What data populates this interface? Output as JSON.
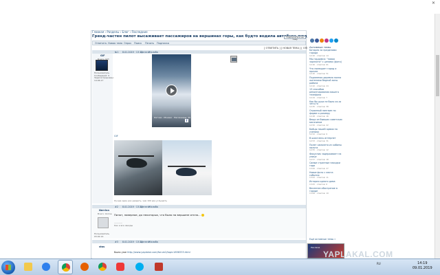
{
  "window": {
    "breadcrumb_label": "Главная › Разделы › Блог › Последние"
  },
  "thread": {
    "title": "Гренд-частен пилот высаживает пассажиров на вершинах горы, как будто водила автобуса людей на остановке",
    "subscribe_button": "Подписаться на тему",
    "toolbar": [
      "Ответить",
      "Новая тема",
      "Опрос",
      "Поиск",
      "Печать",
      "Подписка"
    ],
    "pagination": "[ ОТВЕТИТЬ ] [ НОВАЯ ТЕМА ] [ ОПРОС ]"
  },
  "post1": {
    "header_items": [
      "№1",
      "8.01.2019 · 13:15",
      "Цитата",
      "Жалоба"
    ],
    "username": "GiF",
    "status": "Всего: 373 сообщ.",
    "user_info": "Пользователь\nСообщений: 9\nЗарегистрирован: 14.06.17",
    "video_caption": "Летчик - Монако · Пассажиры: 59",
    "facebook_glyph": "f",
    "small_link": "GIF",
    "footer": "Лучше один раз увидеть, чем 100 раз услышать"
  },
  "post2": {
    "header_items": [
      "#2",
      "8.01.2019 · 13:20",
      "Цитата",
      "Жалоба"
    ],
    "username": "Nerrinn",
    "status": "Всего: Online",
    "user_info": "Пользователь\n03.02.14",
    "message": "Пилот, наверное, до некоторых, что было на вершине отеля...",
    "signature": "————\nКак и все звезды"
  },
  "post3": {
    "header_items": [
      "#3",
      "8.01.2019 · 13:24",
      "Цитата",
      "Жалоба"
    ],
    "username": "stas",
    "message_prefix": "Было уже ",
    "message_link": "http://www.yaplakal.com/forum2/topic1858333.html"
  },
  "sidebar": {
    "title": "Активные темы",
    "items": [
      {
        "title": "Батарея за пределами города",
        "meta": "12:20 · ответов: 14"
      },
      {
        "title": "Мы гордимся: \"новая зарплата\" с ценами (фото)",
        "meta": "12:40 · ответов: 61"
      },
      {
        "title": "Что помещает город и прочее",
        "meta": "12:40 · ответов: 51"
      },
      {
        "title": "Подземная деревня полна жителями бедной зоны района",
        "meta": "12:42 · ответов: 24"
      },
      {
        "title": "13 способов ремонтирования вашего телефона",
        "meta": "12:44 · ответов: 7"
      },
      {
        "title": "Как бы руки не было из-за чего-то",
        "meta": "12:45 · ответов: 38"
      },
      {
        "title": "Огромный пингвин по форме и размеру",
        "meta": "12:48 · ответов: 16"
      },
      {
        "title": "Вещи из бывших советских магазинов",
        "meta": "12:50 · ответов: 22"
      },
      {
        "title": "Бойцы нашей армии на учениях",
        "meta": "12:52 · ответов: 9"
      },
      {
        "title": "В шоке весь интернет",
        "meta": "12:53 · ответов: 31"
      },
      {
        "title": "Полет самолета из кабины пилота",
        "meta": "12:55 · ответов: 12"
      },
      {
        "title": "Фокусник задерживает на улице",
        "meta": "12:57 · ответов: 18"
      },
      {
        "title": "Самые странные находки года",
        "meta": "13:00 · ответов: 27"
      },
      {
        "title": "Новое фото с места события",
        "meta": "13:02 · ответов: 11"
      },
      {
        "title": "История одного дома",
        "meta": "13:05 · ответов: 6"
      },
      {
        "title": "Весеннее обострение в городе",
        "meta": "13:08 · ответов: 19"
      }
    ],
    "more_label": "Ещё активные темы »",
    "ad_text": "Реклама"
  },
  "taskbar": {
    "tray_lang": "RU",
    "time": "14:19",
    "date": "09.01.2019"
  },
  "watermark": "YAPLAKAL.COM",
  "colors": {
    "accent": "#1b3f66",
    "link": "#2a5d8a",
    "header_bg": "#dbe4ec"
  }
}
